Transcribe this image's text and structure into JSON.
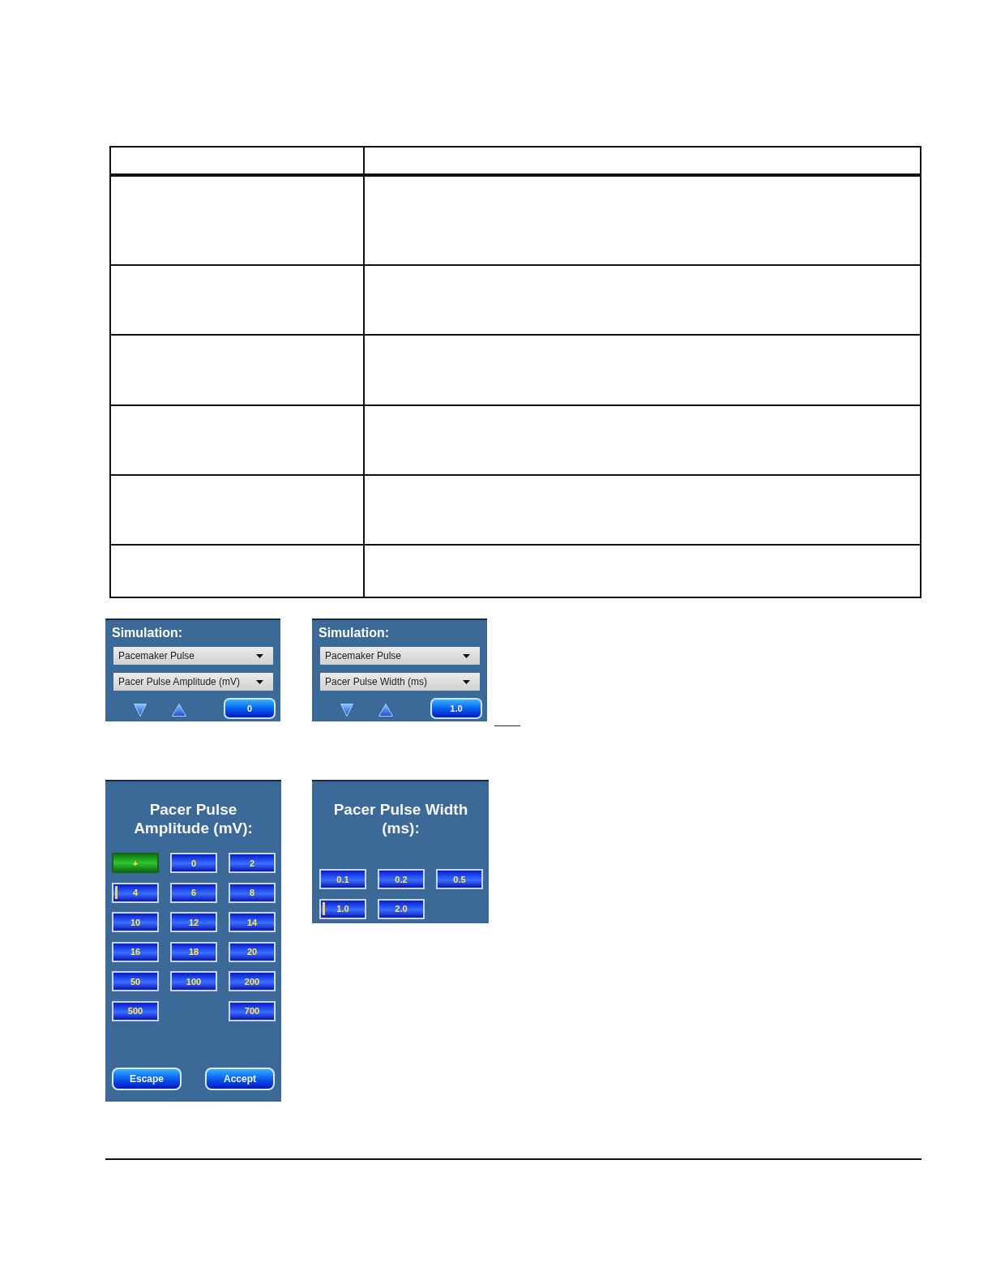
{
  "simulation_panels": [
    {
      "heading": "Simulation:",
      "dropdowns": [
        {
          "value": "Pacemaker Pulse"
        },
        {
          "value": "Pacer Pulse Amplitude (mV)"
        }
      ],
      "value": "0"
    },
    {
      "heading": "Simulation:",
      "dropdowns": [
        {
          "value": "Pacemaker Pulse"
        },
        {
          "value": "Pacer Pulse Width (ms)"
        }
      ],
      "value": "1.0"
    }
  ],
  "keypad_panels": [
    {
      "title": "Pacer Pulse Amplitude (mV):",
      "rows": [
        [
          {
            "kind": "key",
            "label": "+",
            "selected": true,
            "cursor": false
          },
          {
            "kind": "key",
            "label": "0",
            "selected": false,
            "cursor": false
          },
          {
            "kind": "key",
            "label": "2",
            "selected": false,
            "cursor": false
          }
        ],
        [
          {
            "kind": "key",
            "label": "4",
            "selected": false,
            "cursor": true
          },
          {
            "kind": "key",
            "label": "6",
            "selected": false,
            "cursor": false
          },
          {
            "kind": "key",
            "label": "8",
            "selected": false,
            "cursor": false
          }
        ],
        [
          {
            "kind": "key",
            "label": "10",
            "selected": false,
            "cursor": false
          },
          {
            "kind": "key",
            "label": "12",
            "selected": false,
            "cursor": false
          },
          {
            "kind": "key",
            "label": "14",
            "selected": false,
            "cursor": false
          }
        ],
        [
          {
            "kind": "key",
            "label": "16",
            "selected": false,
            "cursor": false
          },
          {
            "kind": "key",
            "label": "18",
            "selected": false,
            "cursor": false
          },
          {
            "kind": "key",
            "label": "20",
            "selected": false,
            "cursor": false
          }
        ],
        [
          {
            "kind": "key",
            "label": "50",
            "selected": false,
            "cursor": false
          },
          {
            "kind": "key",
            "label": "100",
            "selected": false,
            "cursor": false
          },
          {
            "kind": "key",
            "label": "200",
            "selected": false,
            "cursor": false
          }
        ],
        [
          {
            "kind": "key",
            "label": "500",
            "selected": false,
            "cursor": false
          },
          {
            "kind": "gap"
          },
          {
            "kind": "key",
            "label": "700",
            "selected": false,
            "cursor": false
          }
        ]
      ],
      "buttons": [
        "Escape",
        "Accept"
      ]
    },
    {
      "title": "Pacer Pulse Width (ms):",
      "rows": [
        [
          {
            "kind": "key",
            "label": "0.1",
            "selected": false,
            "cursor": false
          },
          {
            "kind": "key",
            "label": "0.2",
            "selected": false,
            "cursor": false
          },
          {
            "kind": "key",
            "label": "0.5",
            "selected": false,
            "cursor": false
          }
        ],
        [
          {
            "kind": "key",
            "label": "1.0",
            "selected": false,
            "cursor": true
          },
          {
            "kind": "key",
            "label": "2.0",
            "selected": false,
            "cursor": false
          }
        ]
      ]
    }
  ]
}
